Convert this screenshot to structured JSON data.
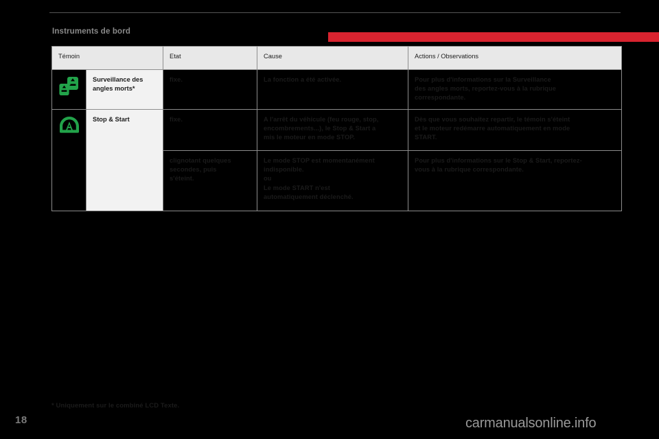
{
  "page": {
    "title": "Instruments de bord",
    "number": "18",
    "accent_color": "#d8232f",
    "watermark": "carmanualsonline.info",
    "footnote": "* Uniquement sur le combiné LCD Texte."
  },
  "table": {
    "headers": [
      "Témoin",
      "",
      "Etat",
      "Cause",
      "Actions / Observations"
    ],
    "header_labels": {
      "temoin": "Témoin",
      "etat": "Etat",
      "cause": "Cause",
      "actions": "Actions / Observations"
    },
    "rows": [
      {
        "icon": "blind-spot-monitoring-icon",
        "icon_color": "#22a34a",
        "name": "Surveillance des angles morts*",
        "etat": "fixe.",
        "cause": "La fonction a été activée.",
        "action_line1": "Pour plus d'informations sur la Surveillance",
        "action_line2": "des angles morts, reportez-vous à la rubrique",
        "action_line3": "correspondante."
      },
      {
        "icon": "stop-and-start-icon",
        "icon_color": "#22a34a",
        "name": "Stop & Start",
        "etat": "fixe.",
        "cause_line1": "A l'arrêt du véhicule (feu rouge, stop,",
        "cause_line2": "encombrements...), le Stop & Start a",
        "cause_line3": "mis le moteur en mode STOP.",
        "action_line1": "Dès que vous souhaitez repartir, le témoin s'éteint",
        "action_line2": "et le moteur redémarre automatiquement en mode",
        "action_line3": "START."
      },
      {
        "etat_line1": "clignotant quelques",
        "etat_line2": "secondes, puis",
        "etat_line3": "s'éteint.",
        "cause_line1": "Le mode STOP est momentanément",
        "cause_line2": "indisponible.",
        "cause_line3": "ou",
        "cause_line4": "Le mode START n'est",
        "cause_line5": "automatiquement déclenché.",
        "action_line1": "Pour plus d'informations sur le Stop & Start, reportez-",
        "action_line2": "vous à la rubrique correspondante."
      }
    ]
  }
}
